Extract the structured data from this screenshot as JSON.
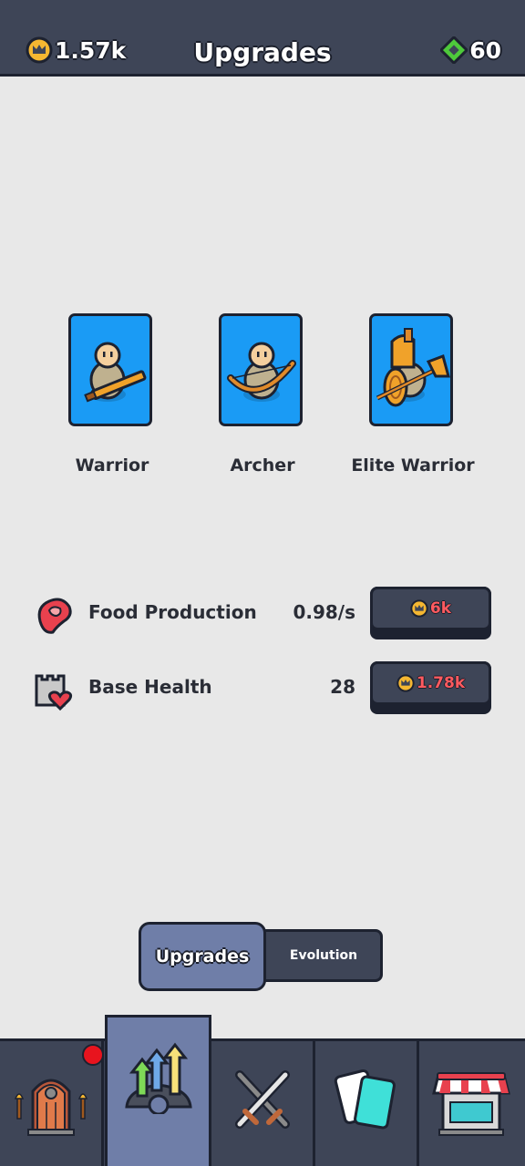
{
  "header": {
    "title": "Upgrades",
    "coins": "1.57k",
    "gems": "60",
    "coin_icon": "crown-coin-icon",
    "gem_icon": "green-gem-icon"
  },
  "units": [
    {
      "name": "Warrior",
      "icon": "warrior-icon"
    },
    {
      "name": "Archer",
      "icon": "archer-icon"
    },
    {
      "name": "Elite Warrior",
      "icon": "elite-warrior-icon"
    }
  ],
  "stats": [
    {
      "name": "Food Production",
      "value": "0.98/s",
      "price": "6k",
      "icon": "meat-icon"
    },
    {
      "name": "Base Health",
      "value": "28",
      "price": "1.78k",
      "icon": "castle-heart-icon"
    }
  ],
  "segments": {
    "upgrades": "Upgrades",
    "evolution": "Evolution"
  },
  "nav": [
    {
      "name": "castle-gate",
      "icon": "door-icon",
      "badge": true
    },
    {
      "name": "upgrades",
      "icon": "upgrade-arrows-icon",
      "active": true
    },
    {
      "name": "battle",
      "icon": "crossed-swords-icon"
    },
    {
      "name": "cards",
      "icon": "cards-icon"
    },
    {
      "name": "shop",
      "icon": "shop-icon"
    }
  ],
  "colors": {
    "bar": "#3e4557",
    "card": "#1a9bf5",
    "active": "#6f7ea8",
    "price": "#ff5a5f"
  }
}
